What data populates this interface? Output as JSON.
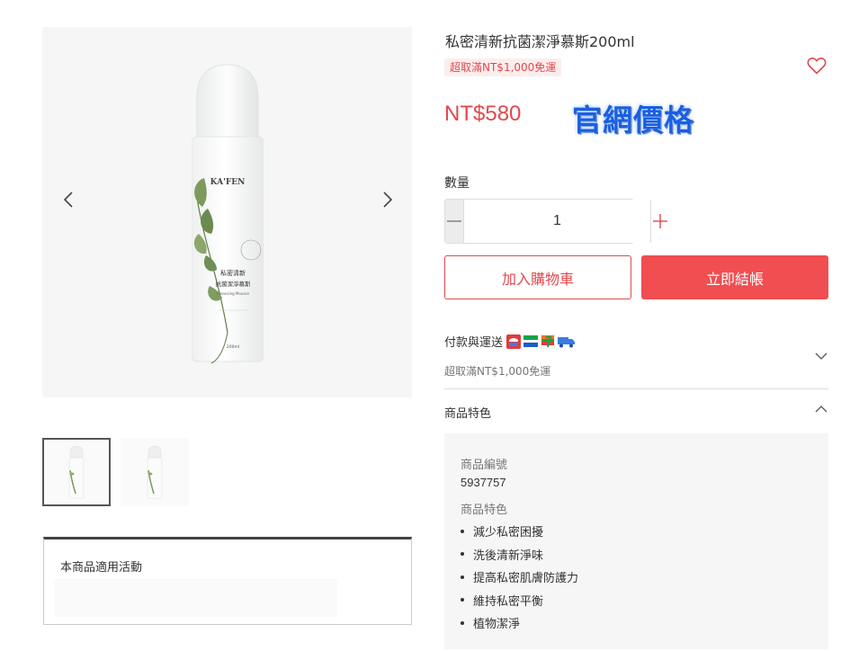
{
  "product": {
    "title": "私密清新抗菌潔淨慕斯200ml",
    "shipping_badge": "超取滿NT$1,000免運",
    "price": "NT$580",
    "overlay_text": "官網價格",
    "bottle": {
      "brand": "KA'FEN",
      "line1": "私密清新",
      "line2": "抗菌潔淨慕斯",
      "line3": "Cleansing Mousse",
      "volume": "200ml"
    }
  },
  "quantity": {
    "label": "數量",
    "value": "1"
  },
  "actions": {
    "add_to_cart": "加入購物車",
    "buy_now": "立即結帳"
  },
  "payment": {
    "label": "付款與運送",
    "subtext": "超取滿NT$1,000免運",
    "icons": [
      "post-office-icon",
      "family-mart-icon",
      "seven-eleven-icon",
      "delivery-truck-icon"
    ]
  },
  "features": {
    "header": "商品特色",
    "code_label": "商品編號",
    "code_value": "5937757",
    "features_label": "商品特色",
    "items": [
      "減少私密困擾",
      "洗後清新淨味",
      "提高私密肌膚防護力",
      "維持私密平衡",
      "植物潔淨"
    ]
  },
  "promo": {
    "title": "本商品適用活動"
  },
  "colors": {
    "accent": "#e0494d",
    "buy_button": "#f04e50",
    "overlay_blue": "#1a5fe0"
  }
}
